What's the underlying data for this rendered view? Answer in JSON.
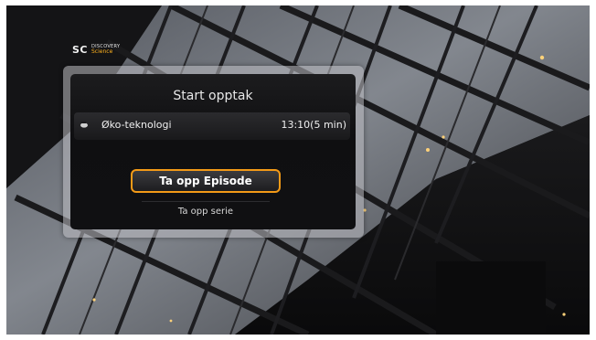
{
  "channel": {
    "logo_mark": "SC",
    "logo_top": "DISCOVERY",
    "logo_bottom": "Science"
  },
  "dialog": {
    "title": "Start opptak",
    "program": {
      "icon": "record-icon",
      "name": "Øko-teknologi",
      "time": "13:10(5 min)"
    },
    "options": {
      "record_episode": "Ta opp Episode",
      "record_series": "Ta opp serie"
    },
    "selected": "record_episode"
  },
  "colors": {
    "focus": "#f39a17",
    "logo_accent": "#ffb21e"
  }
}
